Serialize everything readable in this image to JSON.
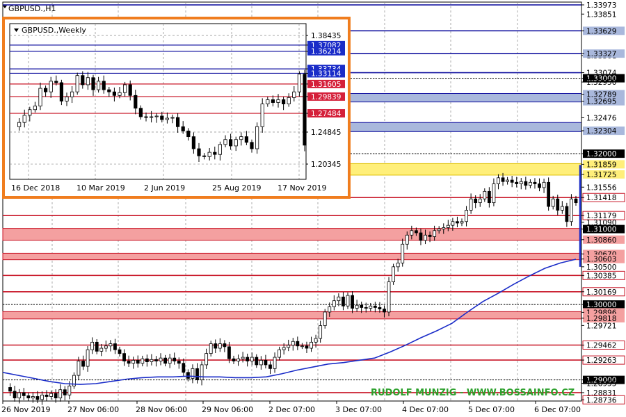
{
  "window": {
    "title": "GBPUSD.,H1"
  },
  "watermark": "RUDOLF MUNZIG - WWW.BOSSAINFO.CZ",
  "colors": {
    "background": "#ffffff",
    "grid": "#888888",
    "resistance_line": "#c81426",
    "support_line": "#1414a0",
    "zone_red": "#f4a0a0",
    "zone_blue": "#a9b8dc",
    "zone_yellow": "#ffef7a",
    "candle": "#000000",
    "ma": "#1a2cc8",
    "inset_border": "#f07d1e",
    "watermark": "#2ca02c"
  },
  "chart_data": [
    {
      "type": "candlestick",
      "title": "GBPUSD.,H1",
      "ylim": [
        1.2872,
        1.3401
      ],
      "x_tick_labels": [
        "26 Nov 2019",
        "27 Nov 06:00",
        "28 Nov 06:00",
        "29 Nov 06:00",
        "2 Dec 07:00",
        "3 Dec 07:00",
        "4 Dec 07:00",
        "5 Dec 07:00",
        "6 Dec 07:00"
      ],
      "price_tick_labels": [
        "1.33973",
        "1.33851",
        "1.33629",
        "1.33301",
        "1.33327",
        "1.33074",
        "1.33000",
        "1.32950",
        "1.32789",
        "1.32695",
        "1.32476",
        "1.32302",
        "1.32304",
        "1.32000",
        "1.31859",
        "1.31725",
        "1.31556",
        "1.31418",
        "1.31179",
        "1.31090",
        "1.31000",
        "1.30860",
        "1.30670",
        "1.30603",
        "1.30500",
        "1.30385",
        "1.30169",
        "1.30000",
        "1.29896",
        "1.29818",
        "1.29721",
        "1.29462",
        "1.29263",
        "1.29000",
        "1.28955",
        "1.28831",
        "1.28736"
      ],
      "levels": [
        {
          "price": 1.33973,
          "kind": "support"
        },
        {
          "price": 1.33629,
          "kind": "support"
        },
        {
          "price": 1.33327,
          "kind": "support"
        },
        {
          "price": 1.33074,
          "kind": "support"
        },
        {
          "price": 1.33,
          "kind": "dotted"
        },
        {
          "price": 1.32,
          "kind": "dotted"
        },
        {
          "price": 1.31418,
          "kind": "resistance"
        },
        {
          "price": 1.31179,
          "kind": "resistance"
        },
        {
          "price": 1.30385,
          "kind": "resistance"
        },
        {
          "price": 1.30169,
          "kind": "resistance"
        },
        {
          "price": 1.3,
          "kind": "dotted"
        },
        {
          "price": 1.29462,
          "kind": "resistance"
        },
        {
          "price": 1.29263,
          "kind": "resistance"
        },
        {
          "price": 1.29,
          "kind": "dotted"
        },
        {
          "price": 1.28831,
          "kind": "resistance"
        }
      ],
      "zones": [
        {
          "from": 1.32695,
          "to": 1.32789,
          "kind": "blue"
        },
        {
          "from": 1.32302,
          "to": 1.32404,
          "kind": "blue"
        },
        {
          "from": 1.31725,
          "to": 1.31859,
          "kind": "yellow"
        },
        {
          "from": 1.3086,
          "to": 1.31,
          "kind": "red"
        },
        {
          "from": 1.30603,
          "to": 1.3067,
          "kind": "red"
        },
        {
          "from": 1.29818,
          "to": 1.29896,
          "kind": "red"
        }
      ],
      "price_path": [
        1.289,
        1.2885,
        1.2876,
        1.2883,
        1.2879,
        1.2876,
        1.2878,
        1.2874,
        1.288,
        1.2878,
        1.2882,
        1.2876,
        1.2887,
        1.288,
        1.2892,
        1.2906,
        1.2925,
        1.2918,
        1.294,
        1.295,
        1.2938,
        1.2942,
        1.2945,
        1.2948,
        1.294,
        1.2935,
        1.2925,
        1.2922,
        1.2926,
        1.2922,
        1.2928,
        1.2924,
        1.2927,
        1.2925,
        1.2929,
        1.2922,
        1.2929,
        1.2925,
        1.2922,
        1.291,
        1.2902,
        1.2915,
        1.29,
        1.292,
        1.2935,
        1.2948,
        1.2942,
        1.2948,
        1.2944,
        1.2928,
        1.2925,
        1.2928,
        1.293,
        1.2925,
        1.293,
        1.292,
        1.2926,
        1.292,
        1.2915,
        1.293,
        1.294,
        1.2943,
        1.2946,
        1.2951,
        1.2945,
        1.2945,
        1.2942,
        1.295,
        1.2955,
        1.2972,
        1.299,
        1.2997,
        1.3005,
        1.301,
        1.2998,
        1.3012,
        1.2995,
        1.2999,
        1.2996,
        1.2995,
        1.2998,
        1.2996,
        1.2994,
        1.299,
        1.303,
        1.305,
        1.3055,
        1.308,
        1.3092,
        1.3098,
        1.3095,
        1.3085,
        1.3092,
        1.309,
        1.3098,
        1.31,
        1.3102,
        1.3105,
        1.311,
        1.3108,
        1.311,
        1.3125,
        1.314,
        1.3135,
        1.314,
        1.315,
        1.3135,
        1.316,
        1.3168,
        1.3163,
        1.3165,
        1.3162,
        1.316,
        1.3163,
        1.3158,
        1.3162,
        1.316,
        1.3155,
        1.3162,
        1.313,
        1.314,
        1.3125,
        1.313,
        1.311,
        1.314,
        1.3135
      ],
      "ma_path": [
        1.291,
        1.2906,
        1.2902,
        1.2898,
        1.2895,
        1.2894,
        1.2895,
        1.2898,
        1.2901,
        1.2903,
        1.2904,
        1.2904,
        1.2905,
        1.2904,
        1.2904,
        1.2903,
        1.2903,
        1.2904,
        1.2908,
        1.2913,
        1.2917,
        1.2921,
        1.2923,
        1.2926,
        1.2929,
        1.2937,
        1.2946,
        1.2956,
        1.2965,
        1.2975,
        1.299,
        1.3004,
        1.3015,
        1.3027,
        1.3038,
        1.3048,
        1.3055,
        1.306
      ],
      "inset": {
        "title": "GBPUSD.,Weekly",
        "x_tick_labels": [
          "16 Dec 2018",
          "10 Mar 2019",
          "2 Jun 2019",
          "25 Aug 2019",
          "17 Nov 2019"
        ],
        "price_tick_labels": [
          "1.38435",
          "1.37082",
          "1.36214",
          "1.33734",
          "1.33114",
          "1.31605",
          "1.29839",
          "1.27484",
          "1.24845",
          "1.20345"
        ],
        "ylim": [
          1.182,
          1.401
        ],
        "levels": [
          {
            "price": 1.37082,
            "kind": "support"
          },
          {
            "price": 1.36214,
            "kind": "support"
          },
          {
            "price": 1.33734,
            "kind": "support"
          },
          {
            "price": 1.33114,
            "kind": "support"
          },
          {
            "price": 1.31605,
            "kind": "resistance"
          },
          {
            "price": 1.29839,
            "kind": "resistance"
          },
          {
            "price": 1.27484,
            "kind": "resistance"
          }
        ],
        "price_path": [
          1.256,
          1.262,
          1.272,
          1.28,
          1.285,
          1.31,
          1.305,
          1.32,
          1.318,
          1.292,
          1.298,
          1.305,
          1.328,
          1.315,
          1.325,
          1.308,
          1.32,
          1.308,
          1.305,
          1.3,
          1.304,
          1.315,
          1.3,
          1.282,
          1.27,
          1.269,
          1.27,
          1.271,
          1.266,
          1.268,
          1.269,
          1.256,
          1.25,
          1.242,
          1.225,
          1.215,
          1.214,
          1.22,
          1.217,
          1.231,
          1.238,
          1.229,
          1.238,
          1.242,
          1.234,
          1.225,
          1.256,
          1.288,
          1.294,
          1.29,
          1.294,
          1.288,
          1.297,
          1.305,
          1.33,
          1.23
        ]
      }
    }
  ]
}
